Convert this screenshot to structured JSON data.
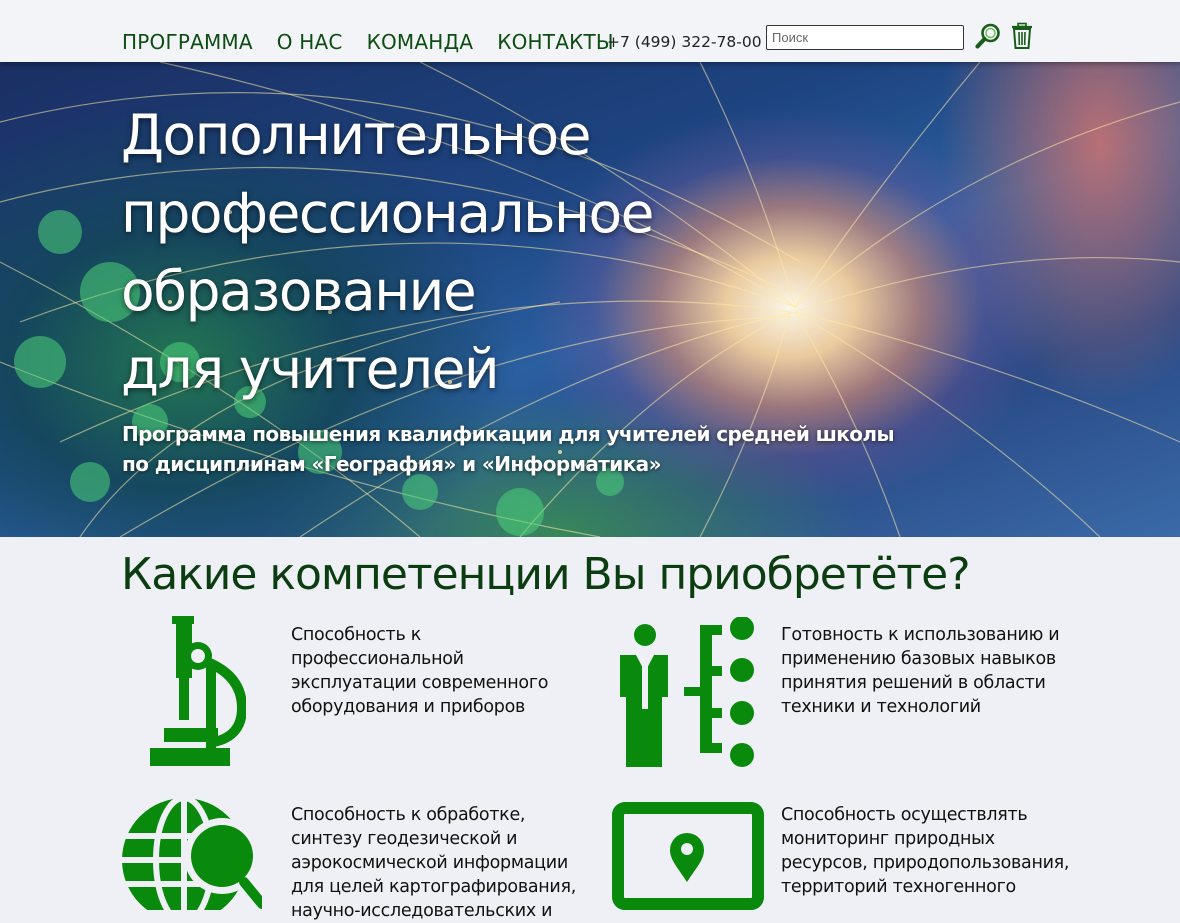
{
  "header": {
    "nav": [
      "ПРОГРАММА",
      "О НАС",
      "КОМАНДА",
      "КОНТАКТЫ"
    ],
    "phone": "+7 (499) 322-78-00",
    "search_placeholder": "Поиск",
    "search_icon": "magnifier-icon",
    "trash_icon": "trash-icon"
  },
  "hero": {
    "title_lines": [
      "Дополнительное",
      "профессиональное",
      "образование",
      "для учителей"
    ],
    "subtitle_lines": [
      "Программа повышения квалификации для учителей средней школы",
      "по дисциплинам «География» и «Информатика»"
    ]
  },
  "competencies": {
    "title": "Какие компетенции Вы приобретёте?",
    "accent_color": "#098a0c",
    "items": [
      {
        "icon": "microscope-icon",
        "text": "Способность к профессиональной эксплуатации современного оборудования и приборов"
      },
      {
        "icon": "decision-tree-icon",
        "text": "Готовность к использованию и применению базовых навыков принятия решений в области техники и технологий"
      },
      {
        "icon": "globe-search-icon",
        "text": "Способность к обработке, синтезу геодезической и аэрокосмической информации для целей картографирования, научно-исследовательских и"
      },
      {
        "icon": "monitor-location-icon",
        "text": "Способность осуществлять мониторинг природных ресурсов, природопользования, территорий техногенного"
      }
    ]
  }
}
